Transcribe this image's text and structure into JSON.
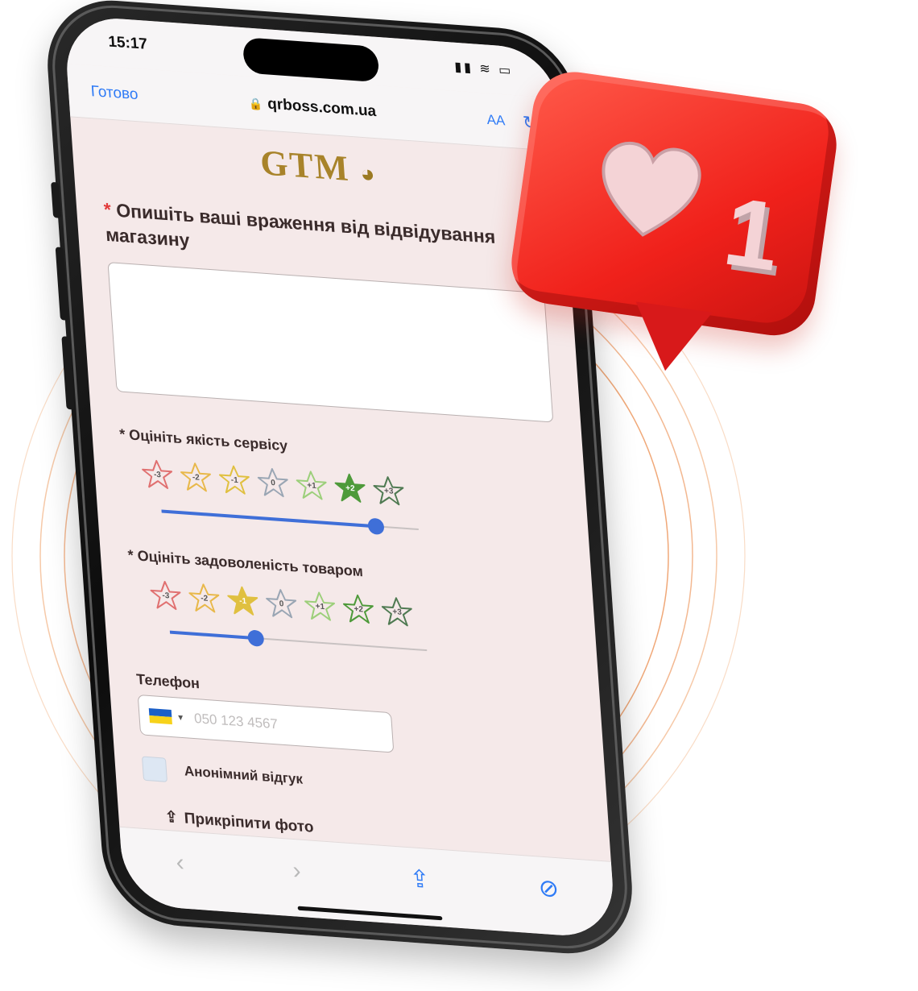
{
  "status_bar": {
    "time": "15:17",
    "icons": "▮▮ ≋ ▭"
  },
  "browser": {
    "done": "Готово",
    "url": "qrboss.com.ua",
    "text_size": "AA",
    "reload": "↻"
  },
  "logo": {
    "text": "GTM"
  },
  "form": {
    "q_main_req": "*",
    "q_main": "Опишіть ваші враження від відвідування магазину",
    "service": {
      "label": "* Оцініть якість сервісу",
      "star_labels": [
        "-3",
        "-2",
        "-1",
        "0",
        "+1",
        "+2",
        "+3"
      ],
      "selected": "+2",
      "value": 2,
      "min": -3,
      "max": 3
    },
    "product": {
      "label": "* Оцініть задоволеність товаром",
      "star_labels": [
        "-3",
        "-2",
        "-1",
        "0",
        "+1",
        "+2",
        "+3"
      ],
      "selected": "-1",
      "value": -1,
      "min": -3,
      "max": 3
    },
    "phone_label": "Телефон",
    "phone_placeholder": "050 123 4567",
    "anon_label": "Анонімний відгук",
    "attach_label": "Прикріпити фото"
  },
  "toolbar": {
    "back": "‹",
    "forward": "›",
    "share": "⇪",
    "safari": "⊘"
  },
  "notification": {
    "count": "1"
  },
  "colors": {
    "accent_orange": "#ff6a22",
    "notif_red": "#f0211b",
    "link_blue": "#2f7bf6",
    "star_colors": [
      "#e07070",
      "#e8b84a",
      "#e0c040",
      "#9aa6b4",
      "#9ccf7a",
      "#4e9a3a",
      "#4f7a52"
    ]
  }
}
